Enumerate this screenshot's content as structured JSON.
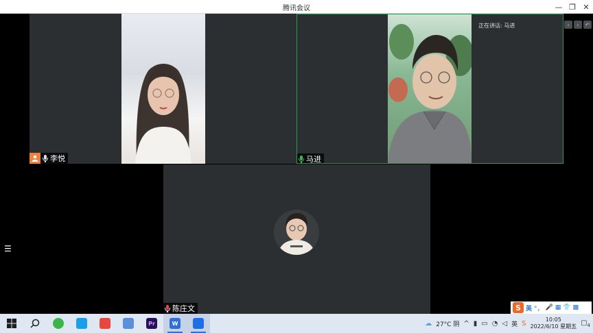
{
  "window": {
    "title": "腾讯会议",
    "minimize": "—",
    "restore": "❐",
    "close": "✕"
  },
  "stage": {
    "speaking_label": "正在讲话: 马进",
    "participants": [
      {
        "name": "李悦",
        "is_host": true,
        "mic": "muted"
      },
      {
        "name": "马进",
        "mic": "active"
      },
      {
        "name": "陈庄文",
        "mic": "muted"
      }
    ],
    "list_toggle": "☰"
  },
  "ime": {
    "logo": "S",
    "lang": "英",
    "items": [
      "°，",
      "🎤",
      "▦",
      "👕",
      "▩"
    ]
  },
  "taskbar": {
    "apps": [
      {
        "name": "start-icon",
        "label": ""
      },
      {
        "name": "search-icon",
        "label": ""
      },
      {
        "name": "browser-icon",
        "label": ""
      },
      {
        "name": "bilibili-icon",
        "label": ""
      },
      {
        "name": "app-red-icon",
        "label": ""
      },
      {
        "name": "monitor-icon",
        "label": ""
      },
      {
        "name": "premiere-icon",
        "label": "Pr"
      },
      {
        "name": "wps-icon",
        "label": "W"
      },
      {
        "name": "tencent-meeting-icon",
        "label": ""
      }
    ],
    "weather": "27°C 阴",
    "ime_indicator": "英",
    "time": "10:05",
    "date": "2022/6/10 星期五",
    "notifications": "4"
  },
  "colors": {
    "active_speaker_border": "#2f9a4b",
    "host_badge": "#f0813a",
    "mic_active": "#3fb550",
    "mic_muted": "#e04b4b",
    "taskbar": "#dfe7f2"
  }
}
